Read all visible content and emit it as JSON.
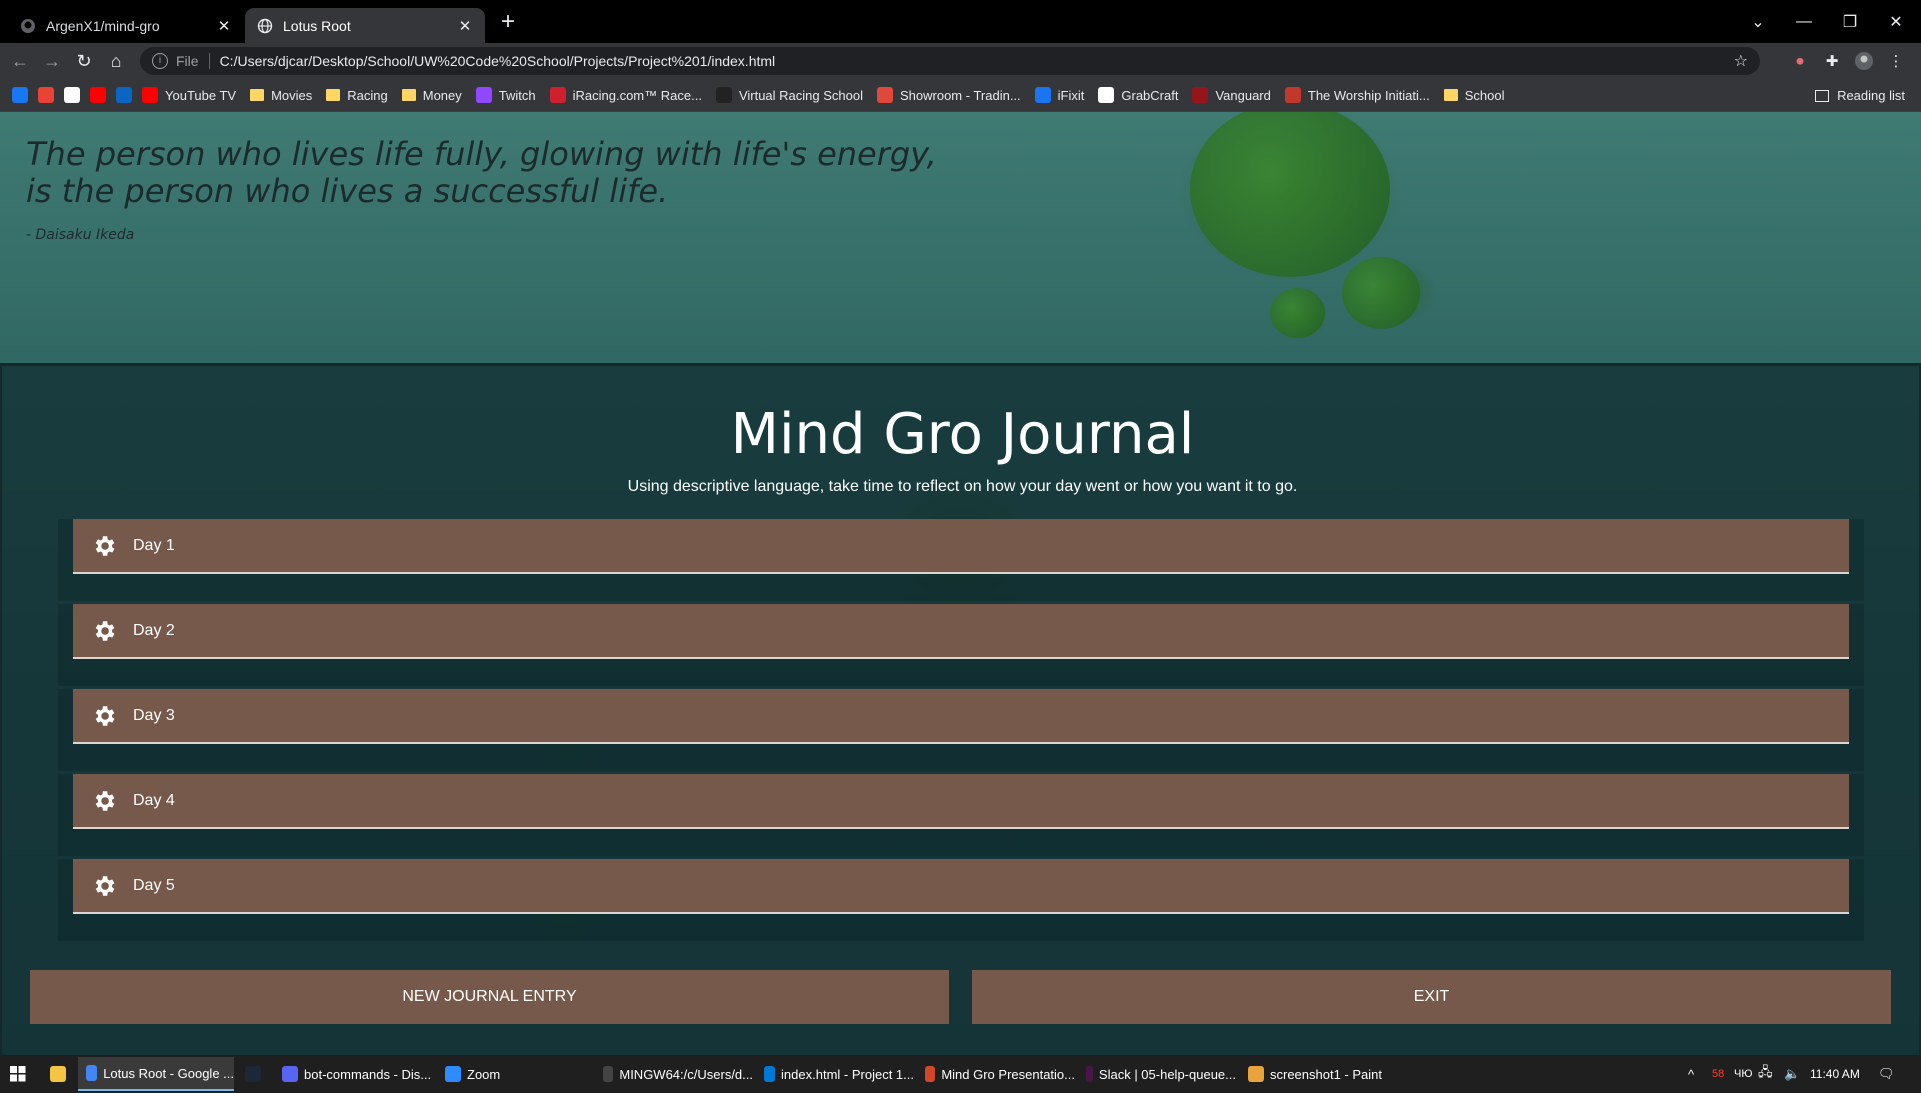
{
  "browser": {
    "tabs": [
      {
        "title": "ArgenX1/mind-gro",
        "active": false
      },
      {
        "title": "Lotus Root",
        "active": true
      }
    ],
    "new_tab": "+",
    "address": {
      "scheme_label": "File",
      "url": "C:/Users/djcar/Desktop/School/UW%20Code%20School/Projects/Project%201/index.html"
    },
    "bookmarks": [
      {
        "label": "",
        "icon": "facebook-icon",
        "color": "#1877f2"
      },
      {
        "label": "",
        "icon": "gmail-icon",
        "color": "#ea4335"
      },
      {
        "label": "",
        "icon": "amazon-icon",
        "color": "#ffffff"
      },
      {
        "label": "",
        "icon": "youtube-icon",
        "color": "#ff0000"
      },
      {
        "label": "",
        "icon": "linkedin-icon",
        "color": "#0a66c2"
      },
      {
        "label": "YouTube TV",
        "icon": "youtube-tv-icon",
        "color": "#ff0000"
      },
      {
        "label": "Movies",
        "icon": "folder-icon",
        "color": "#fdd663"
      },
      {
        "label": "Racing",
        "icon": "folder-icon",
        "color": "#fdd663"
      },
      {
        "label": "Money",
        "icon": "folder-icon",
        "color": "#fdd663"
      },
      {
        "label": "Twitch",
        "icon": "twitch-icon",
        "color": "#9146ff"
      },
      {
        "label": "iRacing.com™ Race...",
        "icon": "iracing-icon",
        "color": "#d01f2f"
      },
      {
        "label": "Virtual Racing School",
        "icon": "vrs-icon",
        "color": "#222222"
      },
      {
        "label": "Showroom - Tradin...",
        "icon": "showroom-icon",
        "color": "#e0483a"
      },
      {
        "label": "iFixit",
        "icon": "ifixit-icon",
        "color": "#1975f2"
      },
      {
        "label": "GrabCraft",
        "icon": "grabcraft-icon",
        "color": "#ffffff"
      },
      {
        "label": "Vanguard",
        "icon": "vanguard-icon",
        "color": "#96151d"
      },
      {
        "label": "The Worship Initiati...",
        "icon": "worship-icon",
        "color": "#c0392b"
      },
      {
        "label": "School",
        "icon": "folder-icon",
        "color": "#fdd663"
      }
    ],
    "reading_list": "Reading list"
  },
  "page": {
    "quote": "The person who lives life fully, glowing with life's energy, is the person who lives a successful life.",
    "author": "- Daisaku Ikeda",
    "title": "Mind Gro Journal",
    "subtitle": "Using descriptive language, take time to reflect on how your day went or how you want it to go.",
    "days": [
      {
        "label": "Day 1"
      },
      {
        "label": "Day 2"
      },
      {
        "label": "Day 3"
      },
      {
        "label": "Day 4"
      },
      {
        "label": "Day 5"
      }
    ],
    "new_entry_button": "NEW JOURNAL ENTRY",
    "exit_button": "EXIT",
    "accent_color": "#77594c"
  },
  "taskbar": {
    "items": [
      {
        "label": "Lotus Root - Google ...",
        "icon": "chrome-icon",
        "active": true
      },
      {
        "label": "",
        "icon": "steam-icon",
        "active": false
      },
      {
        "label": "bot-commands - Dis...",
        "icon": "discord-icon",
        "active": false
      },
      {
        "label": "Zoom",
        "icon": "zoom-icon",
        "active": false
      },
      {
        "label": "MINGW64:/c/Users/d...",
        "icon": "terminal-icon",
        "active": false
      },
      {
        "label": "index.html - Project 1...",
        "icon": "vscode-icon",
        "active": false
      },
      {
        "label": "Mind Gro Presentatio...",
        "icon": "powerpoint-icon",
        "active": false
      },
      {
        "label": "Slack | 05-help-queue...",
        "icon": "slack-icon",
        "active": false
      },
      {
        "label": "screenshot1 - Paint",
        "icon": "paint-icon",
        "active": false
      }
    ],
    "tray": {
      "temp": "58",
      "ime": "ЧЮ",
      "time": "11:40 AM"
    }
  }
}
